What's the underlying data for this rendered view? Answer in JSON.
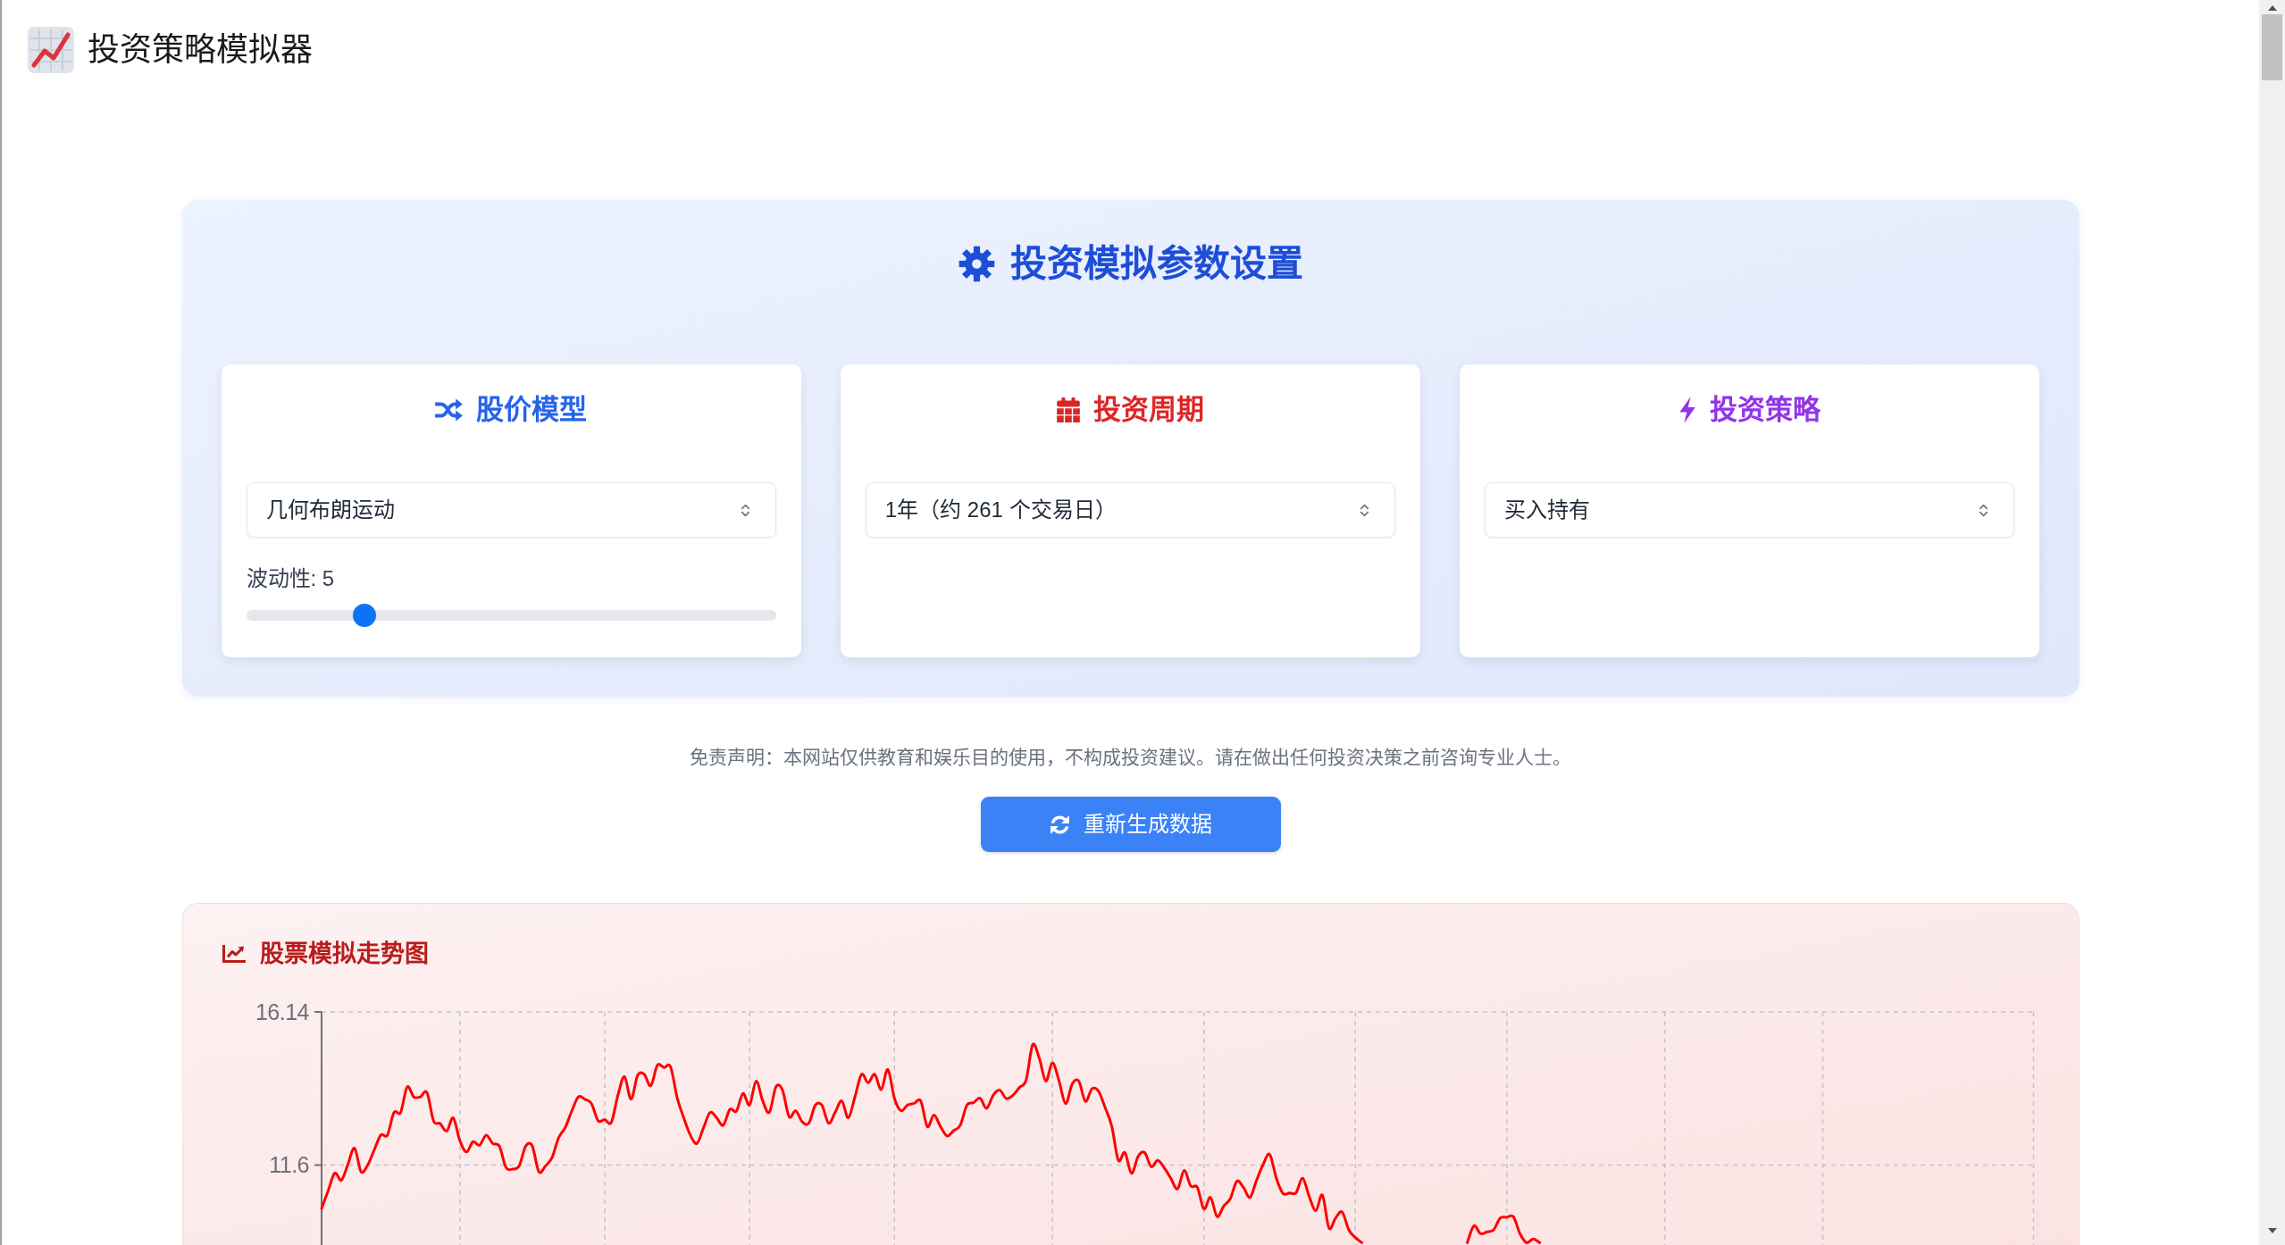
{
  "header": {
    "title": "投资策略模拟器"
  },
  "settings_panel": {
    "title": "投资模拟参数设置",
    "cards": [
      {
        "kind": "model",
        "title": "股价模型",
        "color": "#2563eb",
        "select": {
          "value": "几何布朗运动"
        },
        "slider": {
          "label": "波动性: 5",
          "level": 0.21
        }
      },
      {
        "kind": "period",
        "title": "投资周期",
        "color": "#dc2626",
        "select": {
          "value": "1年（约 261 个交易日）"
        }
      },
      {
        "kind": "strategy",
        "title": "投资策略",
        "color": "#9333ea",
        "select": {
          "value": "买入持有"
        }
      }
    ]
  },
  "disclaimer": "免责声明：本网站仅供教育和娱乐目的使用，不构成投资建议。请在做出任何投资决策之前咨询专业人士。",
  "regenerate_button": {
    "label": "重新生成数据"
  },
  "chart_panel": {
    "title": "股票模拟走势图",
    "chart_data": {
      "type": "line",
      "categories": [
        null,
        null,
        null,
        null,
        null,
        null,
        null,
        null,
        null,
        null,
        null,
        null,
        null,
        null,
        null,
        null,
        null,
        null,
        null,
        null,
        null,
        null,
        null,
        null,
        null,
        null,
        null,
        null,
        null,
        null,
        null,
        null,
        null,
        null,
        null,
        null,
        null,
        null,
        null,
        null,
        null,
        null,
        null,
        null,
        null,
        null,
        null,
        null,
        null,
        null,
        null,
        null,
        null,
        null,
        null,
        null,
        null,
        null,
        null,
        null,
        null,
        null,
        null,
        null,
        null,
        null,
        null,
        null,
        null,
        null,
        null,
        null,
        null,
        null,
        null,
        null,
        null,
        null,
        null,
        null,
        null,
        null,
        null,
        null,
        null,
        null,
        null,
        null,
        null,
        null,
        null,
        null,
        null,
        null,
        null,
        null,
        null,
        null,
        null,
        null,
        null,
        null,
        null,
        null,
        null,
        null,
        null,
        null,
        null,
        null,
        null,
        null,
        null,
        null,
        null,
        null,
        null,
        null,
        null,
        null,
        null,
        null,
        null,
        null,
        null,
        null,
        null,
        null,
        null,
        null,
        null,
        null,
        null,
        null,
        null,
        null,
        null,
        null,
        null,
        null,
        null,
        null,
        null,
        null,
        null,
        null,
        null,
        null,
        null,
        null,
        null,
        null,
        null,
        null,
        null,
        null,
        null,
        null,
        null,
        null,
        null,
        null,
        null,
        null,
        null,
        null,
        null,
        null,
        null,
        null,
        null,
        null,
        null,
        null,
        null,
        null,
        null,
        null,
        null,
        null,
        null,
        null,
        null,
        null,
        null,
        null,
        null,
        null,
        null,
        null,
        null,
        null,
        null,
        null,
        null,
        null,
        null,
        null,
        null,
        null,
        null,
        null,
        null,
        null,
        null,
        null,
        null,
        null,
        null,
        null,
        null,
        null,
        null,
        null,
        null,
        null,
        null,
        null,
        null,
        null,
        null,
        null,
        null,
        null,
        null,
        null,
        null,
        null,
        null,
        null,
        null,
        null,
        null,
        null,
        null,
        null,
        null,
        null,
        null,
        null,
        null,
        null,
        null,
        null,
        null,
        null,
        null,
        null,
        null,
        null,
        null,
        null,
        null,
        null,
        null,
        null,
        null,
        null,
        null,
        null,
        null
      ],
      "series": [
        {
          "color": "#ff0000",
          "values": [
            10.31,
            10.84,
            11.36,
            11.15,
            11.62,
            12.1,
            11.4,
            11.6,
            12.05,
            12.49,
            12.49,
            13.16,
            13.16,
            13.92,
            13.62,
            13.62,
            13.75,
            12.91,
            12.83,
            12.61,
            13.0,
            12.32,
            11.99,
            12.29,
            12.19,
            12.49,
            12.24,
            12.16,
            11.53,
            11.48,
            11.57,
            12.16,
            12.16,
            11.4,
            11.57,
            11.82,
            12.41,
            12.71,
            13.2,
            13.62,
            13.55,
            13.42,
            12.91,
            12.95,
            12.86,
            13.67,
            14.22,
            13.55,
            14.26,
            14.29,
            13.95,
            14.56,
            14.49,
            14.51,
            13.6,
            13.0,
            12.49,
            12.24,
            12.7,
            13.16,
            13.0,
            12.78,
            13.25,
            13.2,
            13.72,
            13.38,
            14.09,
            13.5,
            13.16,
            13.92,
            13.82,
            13.03,
            13.21,
            12.88,
            12.84,
            13.38,
            13.37,
            12.84,
            13.16,
            13.5,
            13.0,
            13.62,
            14.29,
            14.04,
            14.29,
            13.84,
            14.43,
            13.58,
            13.21,
            13.38,
            13.43,
            13.5,
            12.74,
            13.08,
            12.74,
            12.46,
            12.62,
            12.78,
            13.37,
            13.45,
            13.58,
            13.28,
            13.67,
            13.82,
            13.57,
            13.67,
            13.9,
            14.12,
            15.17,
            14.76,
            14.09,
            14.63,
            14.09,
            13.42,
            14.0,
            14.09,
            13.49,
            13.86,
            13.79,
            13.3,
            12.76,
            11.74,
            11.97,
            11.35,
            11.85,
            11.97,
            11.55,
            11.74,
            11.51,
            11.2,
            10.89,
            11.44,
            10.98,
            10.94,
            10.3,
            10.64,
            10.07,
            10.38,
            10.6,
            11.12,
            10.94,
            10.64,
            11.15,
            11.62,
            11.92,
            11.21,
            10.76,
            10.77,
            10.78,
            11.21,
            10.66,
            10.25,
            10.71,
            9.73,
            10.03,
            10.21,
            9.68,
            9.45,
            9.3,
            null,
            null,
            null,
            null,
            null,
            null,
            null,
            null,
            null,
            null,
            null,
            null,
            null,
            null,
            null,
            null,
            null,
            null,
            null,
            null,
            null,
            null,
            null,
            null,
            null,
            null,
            null,
            null,
            null,
            null,
            null,
            null,
            null,
            null,
            null,
            null,
            null,
            null,
            null,
            null,
            null,
            null,
            null,
            null,
            null,
            null,
            null,
            null,
            null,
            null,
            null,
            null,
            null,
            null,
            null,
            null,
            null,
            null,
            null,
            null,
            null,
            null,
            null,
            null,
            null,
            null,
            null,
            null,
            null,
            null,
            null,
            null,
            null,
            null,
            null,
            null,
            null,
            null,
            null,
            null,
            null,
            null,
            null,
            null,
            null,
            null,
            null,
            null,
            null,
            null,
            null,
            null,
            null,
            null,
            null,
            null,
            null,
            null,
            null,
            null,
            null,
            null
          ]
        },
        {
          "color": "#ff0000",
          "values": [
            null,
            null,
            null,
            null,
            null,
            null,
            null,
            null,
            null,
            null,
            null,
            null,
            null,
            null,
            null,
            null,
            null,
            null,
            null,
            null,
            null,
            null,
            null,
            null,
            null,
            null,
            null,
            null,
            null,
            null,
            null,
            null,
            null,
            null,
            null,
            null,
            null,
            null,
            null,
            null,
            null,
            null,
            null,
            null,
            null,
            null,
            null,
            null,
            null,
            null,
            null,
            null,
            null,
            null,
            null,
            null,
            null,
            null,
            null,
            null,
            null,
            null,
            null,
            null,
            null,
            null,
            null,
            null,
            null,
            null,
            null,
            null,
            null,
            null,
            null,
            null,
            null,
            null,
            null,
            null,
            null,
            null,
            null,
            null,
            null,
            null,
            null,
            null,
            null,
            null,
            null,
            null,
            null,
            null,
            null,
            null,
            null,
            null,
            null,
            null,
            null,
            null,
            null,
            null,
            null,
            null,
            null,
            null,
            null,
            null,
            null,
            null,
            null,
            null,
            null,
            null,
            null,
            null,
            null,
            null,
            null,
            null,
            null,
            null,
            null,
            null,
            null,
            null,
            null,
            null,
            null,
            null,
            null,
            null,
            null,
            null,
            null,
            null,
            null,
            null,
            null,
            null,
            null,
            null,
            null,
            null,
            null,
            null,
            null,
            null,
            null,
            null,
            null,
            null,
            null,
            null,
            null,
            null,
            null,
            null,
            null,
            null,
            null,
            null,
            null,
            null,
            null,
            null,
            null,
            null,
            null,
            null,
            null,
            null,
            9.3,
            9.8,
            9.57,
            9.62,
            9.68,
            10.03,
            10.05,
            10.07,
            9.57,
            9.3,
            9.41,
            9.3,
            null,
            null,
            null,
            null,
            null,
            null,
            null,
            null,
            null,
            null,
            null,
            null,
            null,
            null,
            null,
            null,
            null,
            null,
            null,
            null,
            null,
            null,
            null,
            null,
            null,
            null,
            null,
            null,
            null,
            null,
            null,
            null,
            null,
            null,
            null,
            null,
            null,
            null,
            null,
            null,
            null,
            null,
            null,
            null,
            null,
            null,
            null,
            null,
            null,
            null,
            null,
            null,
            null,
            null,
            null,
            null,
            null,
            null,
            null,
            null,
            null,
            null,
            null,
            null,
            null,
            null,
            null,
            null,
            null,
            null,
            null,
            null,
            null,
            null,
            null
          ]
        }
      ],
      "ylim": [
        9.23,
        16.14
      ],
      "yticks": [
        {
          "value": 16.14,
          "label": "16.14"
        },
        {
          "value": 11.6,
          "label": "11.6"
        }
      ]
    }
  }
}
